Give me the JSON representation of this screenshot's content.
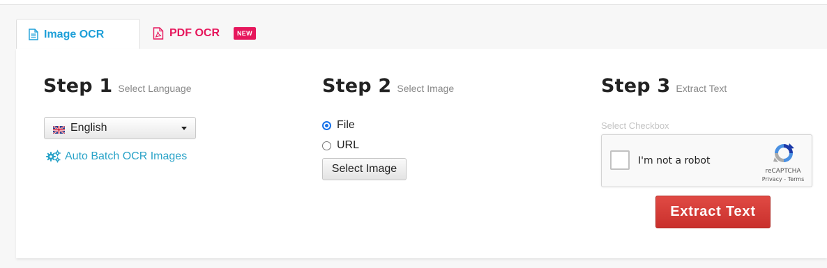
{
  "tabs": {
    "image_ocr": "Image OCR",
    "pdf_ocr": "PDF OCR",
    "new_badge": "NEW"
  },
  "step1": {
    "title": "Step 1",
    "subtitle": "Select Language",
    "language": "English",
    "batch_link": "Auto Batch OCR Images"
  },
  "step2": {
    "title": "Step 2",
    "subtitle": "Select Image",
    "option_file": "File",
    "option_url": "URL",
    "selected_option": "File",
    "select_button": "Select Image"
  },
  "step3": {
    "title": "Step 3",
    "subtitle": "Extract Text",
    "checkbox_label": "Select Checkbox",
    "recaptcha_text": "I'm not a robot",
    "recaptcha_brand": "reCAPTCHA",
    "recaptcha_links": "Privacy - Terms",
    "extract_button": "Extract Text"
  },
  "icons": {
    "image_tab": "document-icon",
    "pdf_tab": "pdf-file-icon",
    "batch": "gears-icon",
    "flag": "uk-flag-icon",
    "recaptcha": "recaptcha-logo-icon"
  },
  "colors": {
    "image_tab_accent": "#1d9fd8",
    "pdf_tab_accent": "#e6175c",
    "link": "#2aa3c8",
    "radio_checked": "#1a73e8",
    "extract_button": "#d9423d"
  }
}
